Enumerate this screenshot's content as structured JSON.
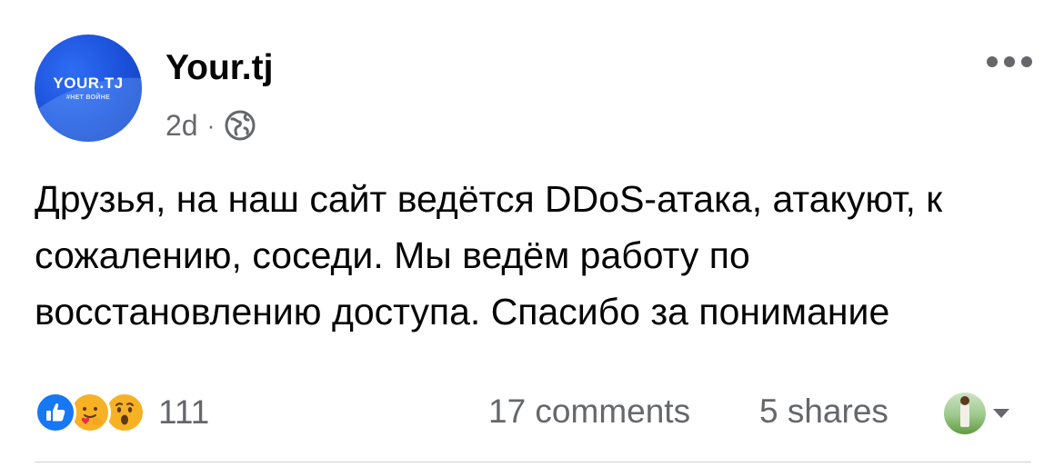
{
  "header": {
    "avatar_logo_text": "YOUR.TJ",
    "avatar_tagline": "#НЕТ ВОЙНЕ",
    "page_name": "Your.tj",
    "timestamp": "2d",
    "separator": "·",
    "audience_icon": "globe-icon",
    "more_icon": "more-options-icon"
  },
  "post": {
    "text": "Друзья, на наш сайт ведётся DDoS-атака, атакуют, к сожалению, соседи. Мы ведём работу по восстановлению доступа. Спасибо за понимание"
  },
  "footer": {
    "reactions": [
      "like-icon",
      "care-icon",
      "wow-icon"
    ],
    "reaction_count": "111",
    "comments": "17 comments",
    "shares": "5 shares",
    "viewer_icon": "viewer-avatar",
    "caret_icon": "caret-down-icon"
  },
  "colors": {
    "brand_blue": "#1877f2",
    "secondary_text": "#65676b",
    "primary_text": "#050505",
    "reaction_yellow": "#f7b125",
    "divider": "#ced0d4"
  }
}
